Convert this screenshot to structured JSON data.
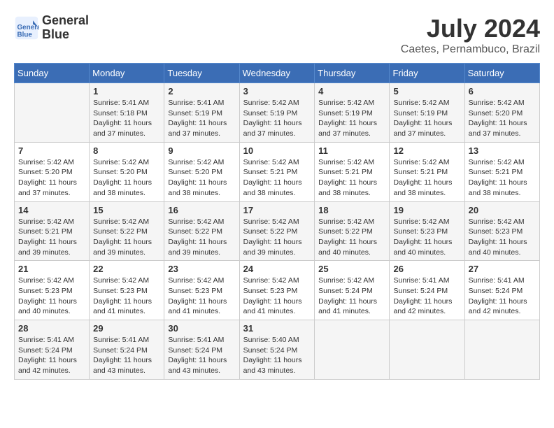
{
  "logo": {
    "name": "General",
    "name2": "Blue"
  },
  "title": "July 2024",
  "location": "Caetes, Pernambuco, Brazil",
  "days_of_week": [
    "Sunday",
    "Monday",
    "Tuesday",
    "Wednesday",
    "Thursday",
    "Friday",
    "Saturday"
  ],
  "weeks": [
    [
      {
        "day": "",
        "info": ""
      },
      {
        "day": "1",
        "info": "Sunrise: 5:41 AM\nSunset: 5:18 PM\nDaylight: 11 hours\nand 37 minutes."
      },
      {
        "day": "2",
        "info": "Sunrise: 5:41 AM\nSunset: 5:19 PM\nDaylight: 11 hours\nand 37 minutes."
      },
      {
        "day": "3",
        "info": "Sunrise: 5:42 AM\nSunset: 5:19 PM\nDaylight: 11 hours\nand 37 minutes."
      },
      {
        "day": "4",
        "info": "Sunrise: 5:42 AM\nSunset: 5:19 PM\nDaylight: 11 hours\nand 37 minutes."
      },
      {
        "day": "5",
        "info": "Sunrise: 5:42 AM\nSunset: 5:19 PM\nDaylight: 11 hours\nand 37 minutes."
      },
      {
        "day": "6",
        "info": "Sunrise: 5:42 AM\nSunset: 5:20 PM\nDaylight: 11 hours\nand 37 minutes."
      }
    ],
    [
      {
        "day": "7",
        "info": "Sunrise: 5:42 AM\nSunset: 5:20 PM\nDaylight: 11 hours\nand 37 minutes."
      },
      {
        "day": "8",
        "info": "Sunrise: 5:42 AM\nSunset: 5:20 PM\nDaylight: 11 hours\nand 38 minutes."
      },
      {
        "day": "9",
        "info": "Sunrise: 5:42 AM\nSunset: 5:20 PM\nDaylight: 11 hours\nand 38 minutes."
      },
      {
        "day": "10",
        "info": "Sunrise: 5:42 AM\nSunset: 5:21 PM\nDaylight: 11 hours\nand 38 minutes."
      },
      {
        "day": "11",
        "info": "Sunrise: 5:42 AM\nSunset: 5:21 PM\nDaylight: 11 hours\nand 38 minutes."
      },
      {
        "day": "12",
        "info": "Sunrise: 5:42 AM\nSunset: 5:21 PM\nDaylight: 11 hours\nand 38 minutes."
      },
      {
        "day": "13",
        "info": "Sunrise: 5:42 AM\nSunset: 5:21 PM\nDaylight: 11 hours\nand 38 minutes."
      }
    ],
    [
      {
        "day": "14",
        "info": "Sunrise: 5:42 AM\nSunset: 5:21 PM\nDaylight: 11 hours\nand 39 minutes."
      },
      {
        "day": "15",
        "info": "Sunrise: 5:42 AM\nSunset: 5:22 PM\nDaylight: 11 hours\nand 39 minutes."
      },
      {
        "day": "16",
        "info": "Sunrise: 5:42 AM\nSunset: 5:22 PM\nDaylight: 11 hours\nand 39 minutes."
      },
      {
        "day": "17",
        "info": "Sunrise: 5:42 AM\nSunset: 5:22 PM\nDaylight: 11 hours\nand 39 minutes."
      },
      {
        "day": "18",
        "info": "Sunrise: 5:42 AM\nSunset: 5:22 PM\nDaylight: 11 hours\nand 40 minutes."
      },
      {
        "day": "19",
        "info": "Sunrise: 5:42 AM\nSunset: 5:23 PM\nDaylight: 11 hours\nand 40 minutes."
      },
      {
        "day": "20",
        "info": "Sunrise: 5:42 AM\nSunset: 5:23 PM\nDaylight: 11 hours\nand 40 minutes."
      }
    ],
    [
      {
        "day": "21",
        "info": "Sunrise: 5:42 AM\nSunset: 5:23 PM\nDaylight: 11 hours\nand 40 minutes."
      },
      {
        "day": "22",
        "info": "Sunrise: 5:42 AM\nSunset: 5:23 PM\nDaylight: 11 hours\nand 41 minutes."
      },
      {
        "day": "23",
        "info": "Sunrise: 5:42 AM\nSunset: 5:23 PM\nDaylight: 11 hours\nand 41 minutes."
      },
      {
        "day": "24",
        "info": "Sunrise: 5:42 AM\nSunset: 5:23 PM\nDaylight: 11 hours\nand 41 minutes."
      },
      {
        "day": "25",
        "info": "Sunrise: 5:42 AM\nSunset: 5:24 PM\nDaylight: 11 hours\nand 41 minutes."
      },
      {
        "day": "26",
        "info": "Sunrise: 5:41 AM\nSunset: 5:24 PM\nDaylight: 11 hours\nand 42 minutes."
      },
      {
        "day": "27",
        "info": "Sunrise: 5:41 AM\nSunset: 5:24 PM\nDaylight: 11 hours\nand 42 minutes."
      }
    ],
    [
      {
        "day": "28",
        "info": "Sunrise: 5:41 AM\nSunset: 5:24 PM\nDaylight: 11 hours\nand 42 minutes."
      },
      {
        "day": "29",
        "info": "Sunrise: 5:41 AM\nSunset: 5:24 PM\nDaylight: 11 hours\nand 43 minutes."
      },
      {
        "day": "30",
        "info": "Sunrise: 5:41 AM\nSunset: 5:24 PM\nDaylight: 11 hours\nand 43 minutes."
      },
      {
        "day": "31",
        "info": "Sunrise: 5:40 AM\nSunset: 5:24 PM\nDaylight: 11 hours\nand 43 minutes."
      },
      {
        "day": "",
        "info": ""
      },
      {
        "day": "",
        "info": ""
      },
      {
        "day": "",
        "info": ""
      }
    ]
  ]
}
